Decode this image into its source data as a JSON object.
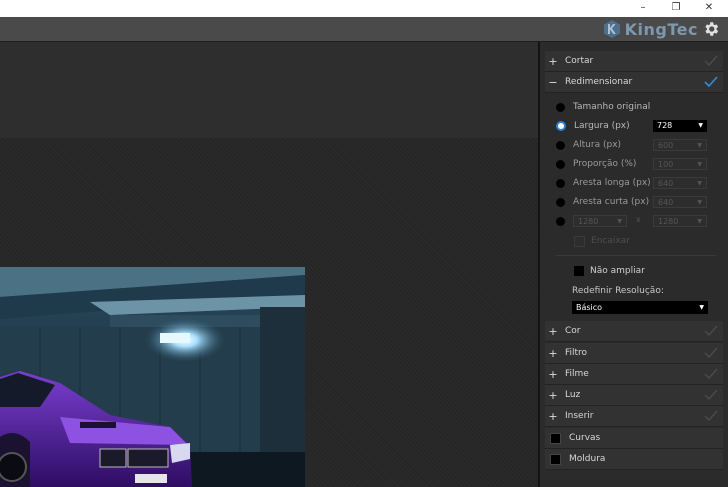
{
  "window": {
    "minimize_glyph": "–",
    "maximize_glyph": "❐",
    "close_glyph": "✕"
  },
  "brand": {
    "name": "KingTec",
    "logo_icon": "kt-logo-icon",
    "settings_icon": "gear-icon"
  },
  "panel": {
    "sections_top": [
      {
        "sign": "+",
        "label": "Cortar",
        "done": false
      },
      {
        "sign": "−",
        "label": "Redimensionar",
        "done": true
      }
    ],
    "resize": {
      "options": [
        {
          "label": "Tamanho original",
          "selected": false,
          "value": null
        },
        {
          "label": "Largura (px)",
          "selected": true,
          "value": "728"
        },
        {
          "label": "Altura (px)",
          "selected": false,
          "value": "600"
        },
        {
          "label": "Proporção (%)",
          "selected": false,
          "value": "100"
        },
        {
          "label": "Aresta longa (px)",
          "selected": false,
          "value": "640"
        },
        {
          "label": "Aresta curta (px)",
          "selected": false,
          "value": "640"
        }
      ],
      "custom": {
        "width": "1280",
        "separator": "x",
        "height": "1280"
      },
      "fill_label": "Encaixar",
      "no_enlarge_label": "Não ampliar",
      "resolution_label": "Redefinir Resolução:",
      "resolution_value": "Básico"
    },
    "sections_bottom": [
      {
        "sign": "+",
        "label": "Cor"
      },
      {
        "sign": "+",
        "label": "Filtro"
      },
      {
        "sign": "+",
        "label": "Filme"
      },
      {
        "sign": "+",
        "label": "Luz"
      },
      {
        "sign": "+",
        "label": "Inserir"
      }
    ],
    "check_sections": [
      {
        "label": "Curvas"
      },
      {
        "label": "Moldura"
      }
    ],
    "colors": {
      "accent": "#2d7fd3",
      "brand": "#7e98b0"
    }
  }
}
